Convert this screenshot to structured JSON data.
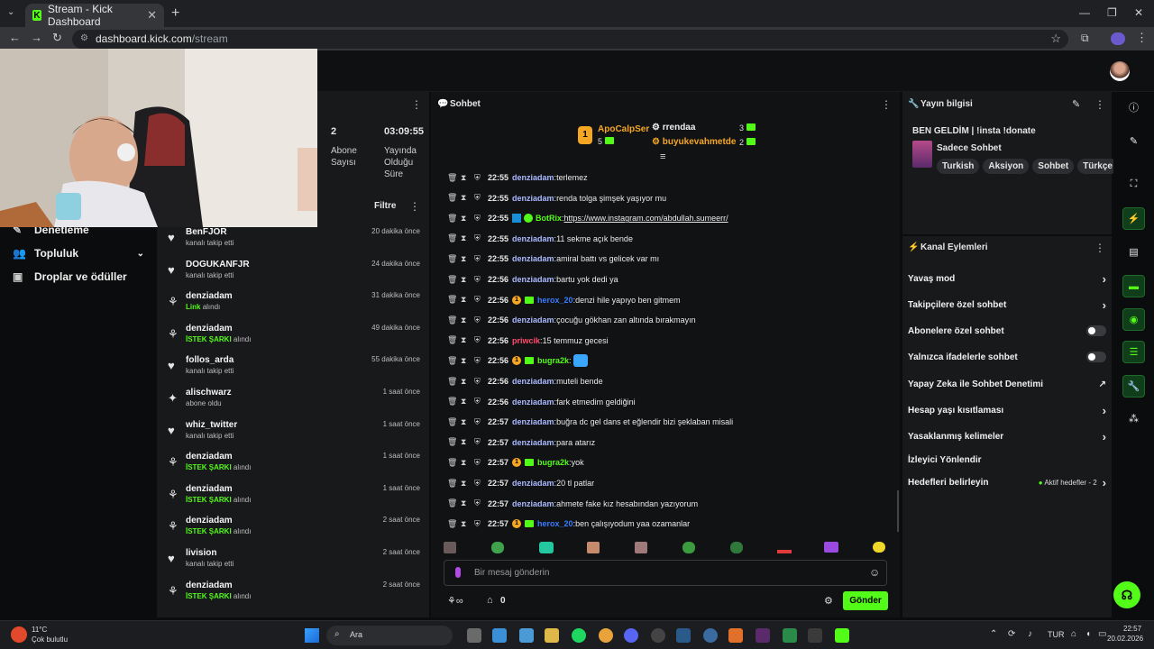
{
  "browser": {
    "tab_title": "Stream - Kick Dashboard",
    "url_host": "dashboard.kick.com",
    "url_path": "/stream"
  },
  "leftnav": {
    "items": [
      {
        "label": "Denetleme"
      },
      {
        "label": "Topluluk"
      },
      {
        "label": "Droplar ve ödüller"
      }
    ]
  },
  "stats": {
    "subs_value": "2",
    "subs_label": "Abone Sayısı",
    "uptime_value": "03:09:55",
    "uptime_label": "Yayında Olduğu Süre"
  },
  "activity": {
    "filter_label": "Filtre",
    "items": [
      {
        "icon": "heart-icon",
        "name": "BenFJOR",
        "prefix": "",
        "sub": "kanalı takip etti",
        "time": "20 dakika önce"
      },
      {
        "icon": "heart-icon",
        "name": "DOGUKANFJR",
        "prefix": "",
        "sub": "kanalı takip etti",
        "time": "24 dakika önce"
      },
      {
        "icon": "points-icon",
        "name": "denziadam",
        "prefix": "Link",
        "sub": "alındı",
        "time": "31 dakika önce"
      },
      {
        "icon": "points-icon",
        "name": "denziadam",
        "prefix": "İSTEK ŞARKI",
        "sub": "alındı",
        "time": "49 dakika önce"
      },
      {
        "icon": "heart-icon",
        "name": "follos_arda",
        "prefix": "",
        "sub": "kanalı takip etti",
        "time": "55 dakika önce"
      },
      {
        "icon": "star-icon",
        "name": "alischwarz",
        "prefix": "",
        "sub": "abone oldu",
        "time": "1 saat önce"
      },
      {
        "icon": "heart-icon",
        "name": "whiz_twitter",
        "prefix": "",
        "sub": "kanalı takip etti",
        "time": "1 saat önce"
      },
      {
        "icon": "points-icon",
        "name": "denziadam",
        "prefix": "İSTEK ŞARKI",
        "sub": "alındı",
        "time": "1 saat önce"
      },
      {
        "icon": "points-icon",
        "name": "denziadam",
        "prefix": "İSTEK ŞARKI",
        "sub": "alındı",
        "time": "1 saat önce"
      },
      {
        "icon": "points-icon",
        "name": "denziadam",
        "prefix": "İSTEK ŞARKI",
        "sub": "alındı",
        "time": "2 saat önce"
      },
      {
        "icon": "heart-icon",
        "name": "livision",
        "prefix": "",
        "sub": "kanalı takip etti",
        "time": "2 saat önce"
      },
      {
        "icon": "points-icon",
        "name": "denziadam",
        "prefix": "İSTEK ŞARKI",
        "sub": "alındı",
        "time": "2 saat önce"
      }
    ]
  },
  "chat": {
    "title": "Sohbet",
    "leader": {
      "name": "ApoCalpSer",
      "count": "5",
      "rank": "1"
    },
    "top2": {
      "name": "rrendaa",
      "count": "3"
    },
    "top3": {
      "name": "buyukevahmetde",
      "count": "2"
    },
    "messages": [
      {
        "time": "22:55",
        "user": "denziadam",
        "color": "#aab9ff",
        "badges": [],
        "text": "terlemez"
      },
      {
        "time": "22:55",
        "user": "denziadam",
        "color": "#aab9ff",
        "badges": [],
        "text": "renda tolga şimşek yaşıyor mu"
      },
      {
        "time": "22:55",
        "user": "BotRix",
        "color": "#53fc18",
        "badges": [
          "bot",
          "verified"
        ],
        "text": "",
        "link": "https://www.instagram.com/abdullah.sumeerr/"
      },
      {
        "time": "22:55",
        "user": "denziadam",
        "color": "#aab9ff",
        "badges": [],
        "text": "11 sekme açık bende"
      },
      {
        "time": "22:55",
        "user": "denziadam",
        "color": "#aab9ff",
        "badges": [],
        "text": "amiral battı vs gelicek var mı"
      },
      {
        "time": "22:56",
        "user": "denziadam",
        "color": "#aab9ff",
        "badges": [],
        "text": "bartu yok dedi ya"
      },
      {
        "time": "22:56",
        "user": "herox_20",
        "color": "#3a7bff",
        "badges": [
          "num",
          "sub"
        ],
        "text": "denzi hile yapıyo ben gitmem"
      },
      {
        "time": "22:56",
        "user": "denziadam",
        "color": "#aab9ff",
        "badges": [],
        "text": "çocuğu gökhan zan altında bırakmayın"
      },
      {
        "time": "22:56",
        "user": "priwcik",
        "color": "#ff4d6d",
        "badges": [],
        "text": "15 temmuz gecesi"
      },
      {
        "time": "22:56",
        "user": "bugra2k",
        "color": "#53fc18",
        "badges": [
          "num",
          "sub"
        ],
        "text": "",
        "emote": true
      },
      {
        "time": "22:56",
        "user": "denziadam",
        "color": "#aab9ff",
        "badges": [],
        "text": "muteli bende"
      },
      {
        "time": "22:56",
        "user": "denziadam",
        "color": "#aab9ff",
        "badges": [],
        "text": "fark etmedim geldiğini"
      },
      {
        "time": "22:57",
        "user": "denziadam",
        "color": "#aab9ff",
        "badges": [],
        "text": "buğra dc gel dans et eğlendir bizi şeklaban misali"
      },
      {
        "time": "22:57",
        "user": "denziadam",
        "color": "#aab9ff",
        "badges": [],
        "text": "para atarız"
      },
      {
        "time": "22:57",
        "user": "bugra2k",
        "color": "#53fc18",
        "badges": [
          "num",
          "sub"
        ],
        "text": "yok"
      },
      {
        "time": "22:57",
        "user": "denziadam",
        "color": "#aab9ff",
        "badges": [],
        "text": "20 tl patlar"
      },
      {
        "time": "22:57",
        "user": "denziadam",
        "color": "#aab9ff",
        "badges": [],
        "text": "ahmete fake kız hesabından yazıyorum"
      },
      {
        "time": "22:57",
        "user": "herox_20",
        "color": "#3a7bff",
        "badges": [
          "num",
          "sub"
        ],
        "text": "ben çalışıyodum yaa ozamanlar"
      }
    ],
    "input_placeholder": "Bir mesaj gönderin",
    "footer_count": "0",
    "send_label": "Gönder"
  },
  "info": {
    "header": "Yayın bilgisi",
    "stream_title": "BEN GELDİM | !insta !donate",
    "category": "Sadece Sohbet",
    "tags": [
      "Turkish",
      "Aksiyon",
      "Sohbet",
      "Türkçe"
    ]
  },
  "actions": {
    "header": "Kanal Eylemleri",
    "items": [
      {
        "label": "Yavaş mod",
        "control": "chevron"
      },
      {
        "label": "Takipçilere özel sohbet",
        "control": "chevron"
      },
      {
        "label": "Abonelere özel sohbet",
        "control": "toggle"
      },
      {
        "label": "Yalnızca ifadelerle sohbet",
        "control": "toggle"
      },
      {
        "label": "Yapay Zeka ile Sohbet Denetimi",
        "control": "external"
      },
      {
        "label": "Hesap yaşı kısıtlaması",
        "control": "chevron"
      },
      {
        "label": "Yasaklanmış kelimeler",
        "control": "chevron"
      },
      {
        "label": "İzleyici Yönlendir",
        "control": "none"
      },
      {
        "label": "Hedefleri belirleyin",
        "control": "chevron",
        "extra": "Aktif hedefler - 2"
      }
    ]
  },
  "taskbar": {
    "weather_temp": "11°C",
    "weather_desc": "Çok bulutlu",
    "search_label": "Ara",
    "lang": "TUR",
    "time": "22:57",
    "date": "20.02.2026"
  },
  "colors": {
    "accent": "#53fc18",
    "panel": "#18191b",
    "bg": "#0b0c0d"
  }
}
